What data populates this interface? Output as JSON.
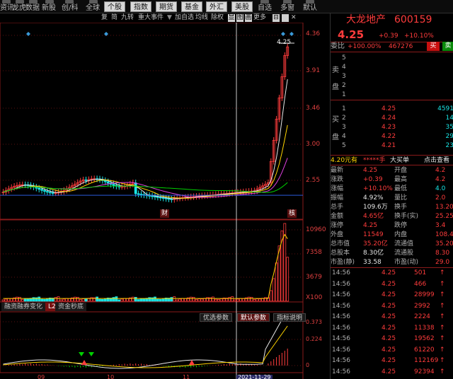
{
  "toolbar": {
    "left": [
      "资讯",
      "龙虎",
      "数据",
      "新股",
      "创/科"
    ],
    "quanqiu": "全球",
    "buttons": [
      "个股",
      "指数",
      "期货",
      "基金",
      "外汇",
      "美股"
    ],
    "right": [
      "自选",
      "多窗",
      "默认"
    ]
  },
  "options": {
    "items": [
      "复",
      "简",
      "九转",
      "重大事件"
    ],
    "items2": [
      "加自选",
      "均线",
      "除权",
      "显",
      "图",
      "画",
      "更多"
    ],
    "box_label": "⊟",
    "close": "✕"
  },
  "chart": {
    "price_axis": [
      "4.36",
      "4.25",
      "3.91",
      "3.46",
      "3.00",
      "2.55"
    ],
    "price_marker": "4.25",
    "event_labels": [
      "财",
      "核"
    ],
    "volume_axis": [
      "10960",
      "7358",
      "3679",
      "X100"
    ],
    "tabs": [
      "融资融券变化",
      "L2",
      "资金秒底"
    ],
    "param_tabs": [
      "优选参数",
      "默认参数",
      "指标说明"
    ],
    "macd_axis": [
      "0.373",
      "0.224",
      "0"
    ],
    "date_axis": [
      "09",
      "10",
      "11",
      "2021-11-29"
    ]
  },
  "stock": {
    "name": "大龙地产",
    "code": "600159",
    "price": "4.25",
    "change": "+0.39",
    "change_pct": "+10.10%",
    "weibi_label": "委比",
    "weibi_value": "+100.00%",
    "weicha_value": "467276",
    "sell_tab": "买",
    "buy_tab": "卖"
  },
  "sell_orders": [
    {
      "level": "5",
      "price": "",
      "vol": ""
    },
    {
      "level": "4",
      "price": "",
      "vol": ""
    },
    {
      "level": "3",
      "price": "",
      "vol": ""
    },
    {
      "level": "2",
      "price": "",
      "vol": ""
    },
    {
      "level": "1",
      "price": "",
      "vol": ""
    }
  ],
  "sell_side_label": [
    "卖",
    "盘"
  ],
  "buy_side_label": [
    "买",
    "盘"
  ],
  "buy_orders": [
    {
      "level": "1",
      "price": "4.25",
      "vol": "4591"
    },
    {
      "level": "2",
      "price": "4.24",
      "vol": "14"
    },
    {
      "level": "3",
      "price": "4.23",
      "vol": "35"
    },
    {
      "level": "4",
      "price": "4.22",
      "vol": "29"
    },
    {
      "level": "5",
      "price": "4.21",
      "vol": "23"
    }
  ],
  "links": {
    "yuan": "4.20元有",
    "hidden": "*****手",
    "daibuydan": "大买单",
    "dianjicha": "点击查看"
  },
  "stats": [
    {
      "k1": "最新",
      "v1": "4.25",
      "k2": "开盘",
      "v2": "4.2"
    },
    {
      "k1": "涨跌",
      "v1": "+0.39",
      "k2": "最高",
      "v2": "4.2"
    },
    {
      "k1": "涨幅",
      "v1": "+10.10%",
      "k2": "最低",
      "v2": "4.0"
    },
    {
      "k1": "振幅",
      "v1": "4.92%",
      "k2": "量比",
      "v2": "2.0"
    },
    {
      "k1": "总手",
      "v1": "109.6万",
      "k2": "换手",
      "v2": "13.20"
    },
    {
      "k1": "金额",
      "v1": "4.65亿",
      "k2": "换手(实)",
      "v2": "25.25"
    },
    {
      "k1": "涨停",
      "v1": "4.25",
      "k2": "跌停",
      "v2": "3.4"
    },
    {
      "k1": "外盘",
      "v1": "11549",
      "k2": "内盘",
      "v2": "108.4"
    },
    {
      "k1": "总市值",
      "v1": "35.20亿",
      "k2": "流通值",
      "v2": "35.20"
    },
    {
      "k1": "总股本",
      "v1": "8.30亿",
      "k2": "流通股",
      "v2": "8.30"
    },
    {
      "k1": "市盈(静)",
      "v1": "33.58",
      "k2": "市盈(动)",
      "v2": "29.0"
    }
  ],
  "trades": [
    {
      "t": "14:56",
      "p": "4.25",
      "v": "501"
    },
    {
      "t": "14:56",
      "p": "4.25",
      "v": "466"
    },
    {
      "t": "14:56",
      "p": "4.25",
      "v": "28999"
    },
    {
      "t": "14:56",
      "p": "4.25",
      "v": "2992"
    },
    {
      "t": "14:56",
      "p": "4.25",
      "v": "2224"
    },
    {
      "t": "14:56",
      "p": "4.25",
      "v": "11338"
    },
    {
      "t": "14:56",
      "p": "4.25",
      "v": "19562"
    },
    {
      "t": "14:56",
      "p": "4.25",
      "v": "61220"
    },
    {
      "t": "14:56",
      "p": "4.25",
      "v": "112169"
    },
    {
      "t": "14:56",
      "p": "4.25",
      "v": "92394"
    }
  ],
  "colors": {
    "up": "#ff3c3c",
    "down": "#19e4e4",
    "buy": "#00d000",
    "volume": "#ffd400",
    "accent": "#8a1a1a"
  }
}
